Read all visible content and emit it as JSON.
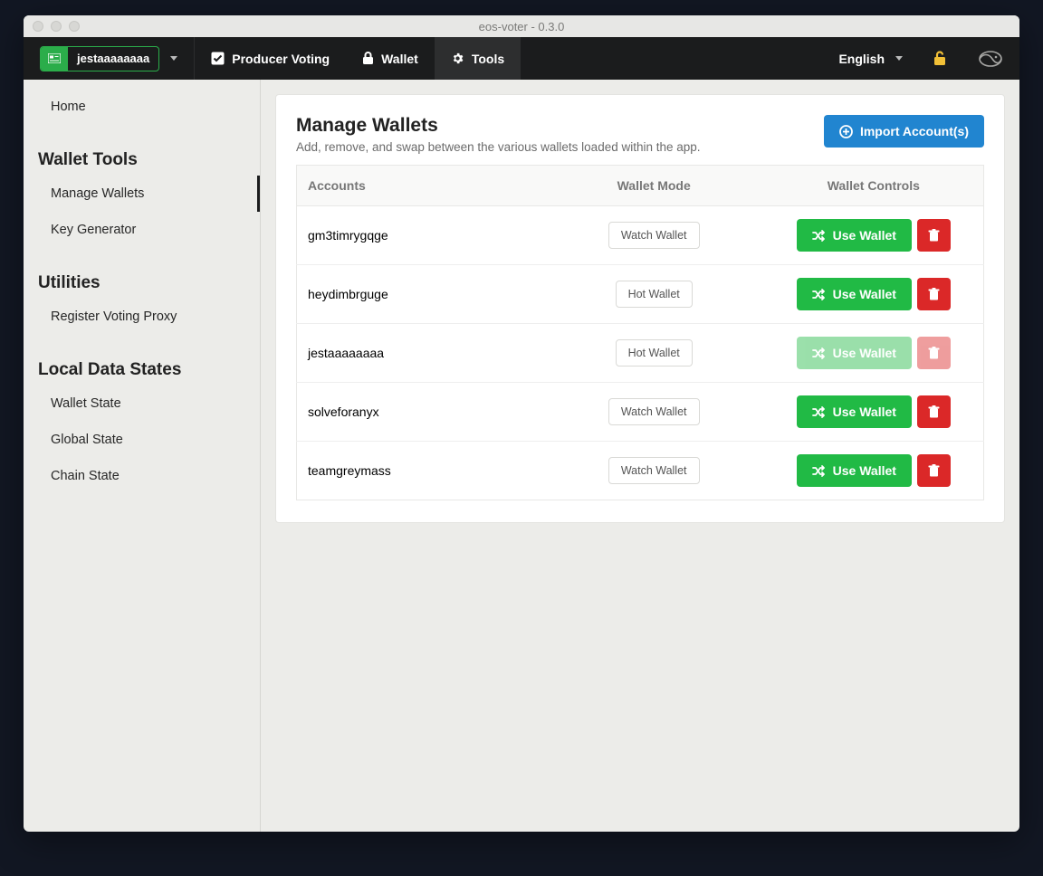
{
  "window": {
    "title": "eos-voter - 0.3.0"
  },
  "menubar": {
    "account": "jestaaaaaaaa",
    "producer_voting": "Producer Voting",
    "wallet": "Wallet",
    "tools": "Tools",
    "language": "English"
  },
  "sidebar": {
    "home": "Home",
    "section_wallet_tools": "Wallet Tools",
    "manage_wallets": "Manage Wallets",
    "key_generator": "Key Generator",
    "section_utilities": "Utilities",
    "register_voting_proxy": "Register Voting Proxy",
    "section_local_data": "Local Data States",
    "wallet_state": "Wallet State",
    "global_state": "Global State",
    "chain_state": "Chain State"
  },
  "panel": {
    "title": "Manage Wallets",
    "subtitle": "Add, remove, and swap between the various wallets loaded within the app.",
    "import_button": "Import Account(s)"
  },
  "table": {
    "headers": {
      "accounts": "Accounts",
      "mode": "Wallet Mode",
      "controls": "Wallet Controls"
    },
    "use_wallet_label": "Use Wallet",
    "rows": [
      {
        "account": "gm3timrygqge",
        "mode": "Watch Wallet",
        "active": false
      },
      {
        "account": "heydimbrguge",
        "mode": "Hot Wallet",
        "active": false
      },
      {
        "account": "jestaaaaaaaa",
        "mode": "Hot Wallet",
        "active": true
      },
      {
        "account": "solveforanyx",
        "mode": "Watch Wallet",
        "active": false
      },
      {
        "account": "teamgreymass",
        "mode": "Watch Wallet",
        "active": false
      }
    ]
  }
}
